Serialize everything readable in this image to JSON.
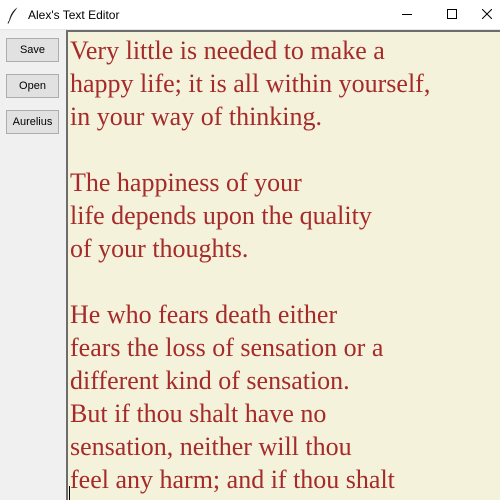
{
  "window": {
    "title": "Alex's Text Editor",
    "icon": "feather-icon",
    "controls": [
      "minimize-icon",
      "maximize-icon",
      "close-icon"
    ]
  },
  "sidebar": {
    "save_label": "Save",
    "open_label": "Open",
    "aurelius_label": "Aurelius"
  },
  "editor": {
    "background": "#f5f2dc",
    "text_color": "#a52a2a",
    "lines": [
      "Very little is needed to make a",
      "happy life; it is all within yourself,",
      "in your way of thinking.",
      "",
      "The happiness of your",
      "life depends upon the quality",
      "of your thoughts.",
      "",
      "He who fears death either",
      "fears the loss of sensation or a",
      "different kind of sensation.",
      "But if thou shalt have no",
      "sensation, neither will thou",
      "feel any harm; and if thou shalt"
    ]
  }
}
